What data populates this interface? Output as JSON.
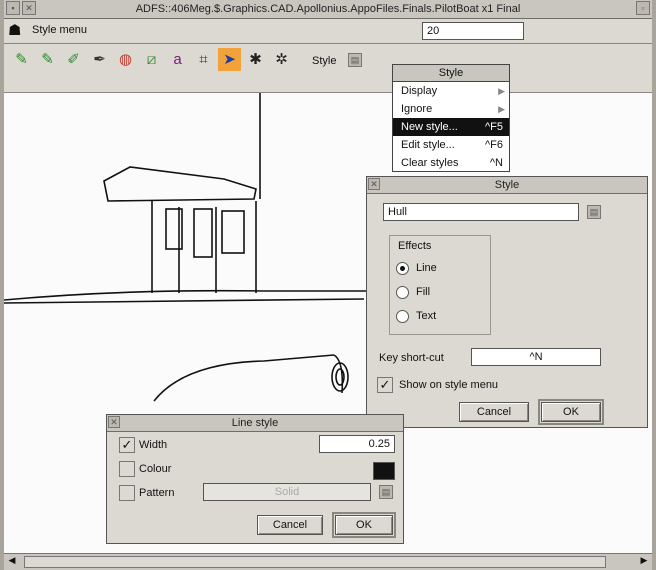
{
  "window": {
    "title": "ADFS::406Meg.$.Graphics.CAD.Apollonius.AppoFiles.Finals.PilotBoat x1 Final"
  },
  "infobar": {
    "mode_label": "Style menu",
    "value": "20"
  },
  "toolbar": {
    "style_label": "Style",
    "tools": [
      {
        "icon": "pencil-green-icon",
        "glyph": "✎",
        "color": "#2a8a2a"
      },
      {
        "icon": "pencil-multi-icon",
        "glyph": "✎",
        "color": "#2a8a2a"
      },
      {
        "icon": "pencil-curve-icon",
        "glyph": "✐",
        "color": "#2a8a2a"
      },
      {
        "icon": "pen-style-icon",
        "glyph": "✒",
        "color": "#333333"
      },
      {
        "icon": "circle-tool-icon",
        "glyph": "◍",
        "color": "#c0392b"
      },
      {
        "icon": "line-tool-icon",
        "glyph": "⧄",
        "color": "#2a8a2a"
      },
      {
        "icon": "text-tool-icon",
        "glyph": "a",
        "color": "#7a1a7a"
      },
      {
        "icon": "dimension-tool-icon",
        "glyph": "⌗",
        "color": "#333333"
      },
      {
        "icon": "select-arrow-icon",
        "glyph": "➤",
        "color": "#1b3fa0"
      },
      {
        "icon": "bug-a-icon",
        "glyph": "✱",
        "color": "#222222"
      },
      {
        "icon": "bug-b-icon",
        "glyph": "✲",
        "color": "#222222"
      }
    ]
  },
  "style_menu": {
    "title": "Style",
    "items": [
      {
        "label": "Display",
        "shortcut": "",
        "submenu": true
      },
      {
        "label": "Ignore",
        "shortcut": "",
        "submenu": true
      },
      {
        "label": "New style...",
        "shortcut": "^F5",
        "highlighted": true
      },
      {
        "label": "Edit style...",
        "shortcut": "^F6"
      },
      {
        "label": "Clear styles",
        "shortcut": "^N"
      }
    ]
  },
  "style_dialog": {
    "title": "Style",
    "name_value": "Hull",
    "effects_label": "Effects",
    "effects": [
      {
        "label": "Line",
        "selected": true
      },
      {
        "label": "Fill",
        "selected": false
      },
      {
        "label": "Text",
        "selected": false
      }
    ],
    "shortcut_label": "Key short-cut",
    "shortcut_value": "^N",
    "show_on_menu_label": "Show on style menu",
    "show_on_menu_checked": true,
    "cancel_label": "Cancel",
    "ok_label": "OK"
  },
  "line_style_dialog": {
    "title": "Line style",
    "width_label": "Width",
    "width_checked": true,
    "width_value": "0.25",
    "colour_label": "Colour",
    "colour_value": "#111111",
    "pattern_label": "Pattern",
    "pattern_value": "Solid",
    "cancel_label": "Cancel",
    "ok_label": "OK"
  }
}
